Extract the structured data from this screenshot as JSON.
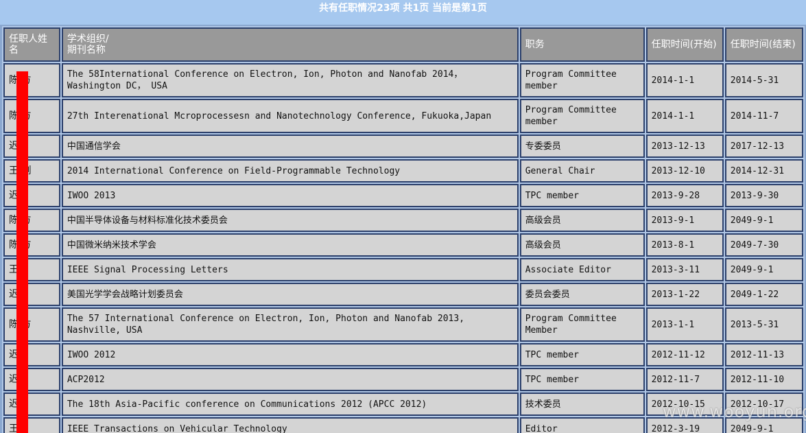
{
  "summary": "共有任职情况23项  共1页  当前是第1页",
  "headers": {
    "name": "任职人姓名",
    "org": "学术组织/\n期刊名称",
    "role": "职务",
    "start": "任职时间(开始)",
    "end": "任职时间(结束)"
  },
  "rows": [
    {
      "name": "陈 方",
      "org": "The 58International Conference on Electron, Ion, Photon and Nanofab 2014， Washington DC， USA",
      "role": "Program Committee member",
      "start": "2014-1-1",
      "end": "2014-5-31",
      "tall": true
    },
    {
      "name": "陈 方",
      "org": "27th Interenational Mcroprocessesn and Nanotechnology Conference, Fukuoka,Japan",
      "role": "Program Committee member",
      "start": "2014-1-1",
      "end": "2014-11-7",
      "tall": true
    },
    {
      "name": "迟",
      "org": "中国通信学会",
      "role": "专委委员",
      "start": "2013-12-13",
      "end": "2017-12-13",
      "tall": false
    },
    {
      "name": "王 俐",
      "org": "2014 International Conference on Field-Programmable Technology",
      "role": "General Chair",
      "start": "2013-12-10",
      "end": "2014-12-31",
      "tall": false
    },
    {
      "name": "迟",
      "org": "IWOO 2013",
      "role": "TPC member",
      "start": "2013-9-28",
      "end": "2013-9-30",
      "tall": false
    },
    {
      "name": "陈 方",
      "org": "中国半导体设备与材料标准化技术委员会",
      "role": "高级会员",
      "start": "2013-9-1",
      "end": "2049-9-1",
      "tall": false
    },
    {
      "name": "陈 方",
      "org": "中国微米纳米技术学会",
      "role": "高级会员",
      "start": "2013-8-1",
      "end": "2049-7-30",
      "tall": false
    },
    {
      "name": "王",
      "org": "IEEE Signal Processing Letters",
      "role": "Associate Editor",
      "start": "2013-3-11",
      "end": "2049-9-1",
      "tall": false
    },
    {
      "name": "迟",
      "org": "美国光学学会战略计划委员会",
      "role": "委员会委员",
      "start": "2013-1-22",
      "end": "2049-1-22",
      "tall": false
    },
    {
      "name": "陈 方",
      "org": "The 57 International Conference on Electron, Ion, Photon and Nanofab 2013, Nashville, USA",
      "role": "Program Committee Member",
      "start": "2013-1-1",
      "end": "2013-5-31",
      "tall": true
    },
    {
      "name": "迟",
      "org": "IWOO 2012",
      "role": "TPC member",
      "start": "2012-11-12",
      "end": "2012-11-13",
      "tall": false
    },
    {
      "name": "迟",
      "org": "ACP2012",
      "role": "TPC member",
      "start": "2012-11-7",
      "end": "2012-11-10",
      "tall": false
    },
    {
      "name": "迟",
      "org": "The 18th Asia-Pacific conference on Communications 2012 (APCC 2012)",
      "role": "技术委员",
      "start": "2012-10-15",
      "end": "2012-10-17",
      "tall": false
    },
    {
      "name": "王",
      "org": "IEEE Transactions on Vehicular Technology",
      "role": "Editor",
      "start": "2012-3-19",
      "end": "2049-9-1",
      "tall": false
    }
  ],
  "watermark": "www.wooyun.org",
  "colors": {
    "header_bg": "#999999",
    "cell_bg": "#d4d4d4",
    "summary_bg": "#a6c8ef",
    "border": "#2b3f6a",
    "redaction": "#ff0000"
  }
}
